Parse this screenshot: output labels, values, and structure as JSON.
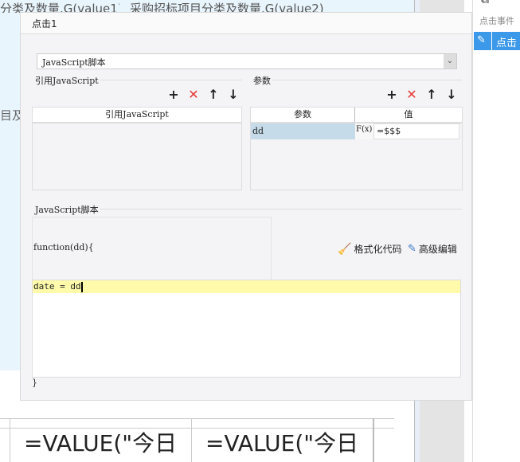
{
  "sheet": {
    "header_cells": [
      "分类及数量.G(value1)",
      "采购招标项目分类及数量.G(value2)"
    ],
    "side_text": "目及",
    "bottom_cells": [
      "=VALUE(\"今日",
      "=VALUE(\"今日"
    ]
  },
  "right_panel": {
    "section_label": "点击事件",
    "item_label": "点击"
  },
  "dialog": {
    "title": "点击1",
    "type_select": "JavaScript脚本",
    "ref_js": {
      "legend": "引用JavaScript",
      "column": "引用JavaScript"
    },
    "params": {
      "legend": "参数",
      "columns": [
        "参数",
        "值"
      ],
      "rows": [
        {
          "name": "dd",
          "value": "=$$$"
        }
      ],
      "formula_label": "F(x)"
    },
    "script": {
      "legend": "JavaScript脚本",
      "header": "function(dd){",
      "code": "date = dd",
      "footer": "}",
      "format_label": "格式化代码",
      "advanced_label": "高级编辑"
    }
  },
  "colors": {
    "accent": "#3c98e8",
    "delete": "#e53935",
    "selected_row": "#c5dbe9",
    "current_line": "#fffbaa"
  }
}
